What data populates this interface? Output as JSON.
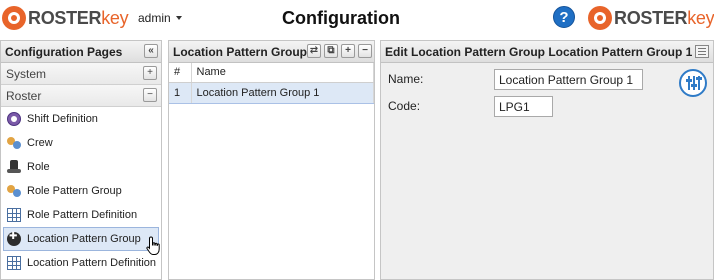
{
  "header": {
    "logo_roster": "ROSTER",
    "logo_key": "key",
    "user": "admin",
    "title": "Configuration",
    "help": "?"
  },
  "sidebar": {
    "title": "Configuration Pages",
    "collapse_glyph": "«",
    "sections": [
      {
        "label": "System",
        "toggle": "+"
      },
      {
        "label": "Roster",
        "toggle": "−"
      }
    ],
    "items": [
      {
        "label": "Shift Definition",
        "icon": "clock-icon"
      },
      {
        "label": "Crew",
        "icon": "people-icon"
      },
      {
        "label": "Role",
        "icon": "hat-icon"
      },
      {
        "label": "Role Pattern Group",
        "icon": "people-icon"
      },
      {
        "label": "Role Pattern Definition",
        "icon": "grid-icon"
      },
      {
        "label": "Location Pattern Group",
        "icon": "location-icon",
        "active": true
      },
      {
        "label": "Location Pattern Definition",
        "icon": "grid-icon"
      }
    ]
  },
  "list_panel": {
    "title": "Location Pattern Group",
    "columns": [
      "#",
      "Name"
    ],
    "rows": [
      {
        "num": "1",
        "name": "Location Pattern Group 1",
        "selected": true
      }
    ]
  },
  "edit_panel": {
    "title": "Edit Location Pattern Group Location Pattern Group 1",
    "name_label": "Name:",
    "name_value": "Location Pattern Group 1",
    "code_label": "Code:",
    "code_value": "LPG1"
  },
  "colors": {
    "brand_orange": "#e8642a",
    "selection": "#dde8f6",
    "help_blue": "#1f6fc4"
  }
}
